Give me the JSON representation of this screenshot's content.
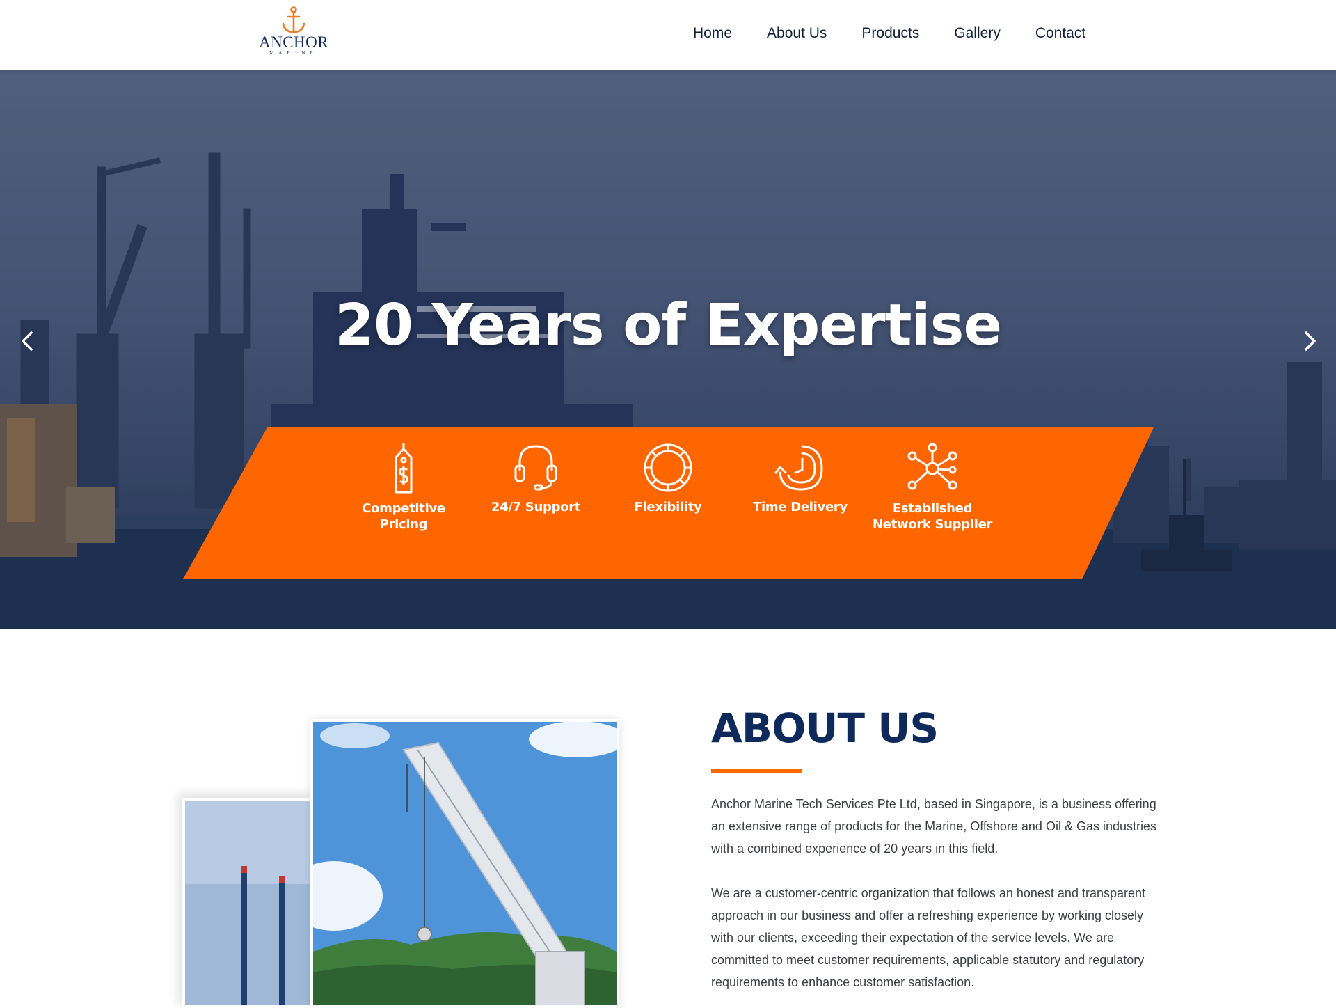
{
  "header": {
    "logo": {
      "word": "ANCHOR",
      "sub": "MARINE",
      "icon": "anchor-icon",
      "color": "#f07a1e"
    },
    "nav": [
      {
        "label": "Home"
      },
      {
        "label": "About Us"
      },
      {
        "label": "Products"
      },
      {
        "label": "Gallery"
      },
      {
        "label": "Contact"
      }
    ]
  },
  "hero": {
    "title": "20 Years of Expertise",
    "prev_icon": "chevron-left-icon",
    "next_icon": "chevron-right-icon",
    "banner_color": "#ff6600",
    "features": [
      {
        "label": "Competitive Pricing",
        "icon": "price-tag-icon"
      },
      {
        "label": "24/7 Support",
        "icon": "headset-icon"
      },
      {
        "label": "Flexibility",
        "icon": "flexible-circle-icon"
      },
      {
        "label": "Time Delivery",
        "icon": "clock-arrow-icon"
      },
      {
        "label": "Established Network Supplier",
        "icon": "network-icon"
      }
    ]
  },
  "about": {
    "title": "ABOUT US",
    "accent": "#ff6a00",
    "title_color": "#0d2a5a",
    "paragraphs": [
      "Anchor Marine Tech Services Pte Ltd, based in Singapore, is a business offering an extensive range of products for the Marine, Offshore and Oil & Gas industries with a combined experience of 20 years in this field.",
      "We are a customer-centric organization that follows an honest and transparent approach in our business and offer a refreshing experience by working closely with our clients, exceeding their expectation of the service levels. We are committed to meet customer requirements, applicable statutory and regulatory requirements to enhance customer satisfaction."
    ]
  }
}
